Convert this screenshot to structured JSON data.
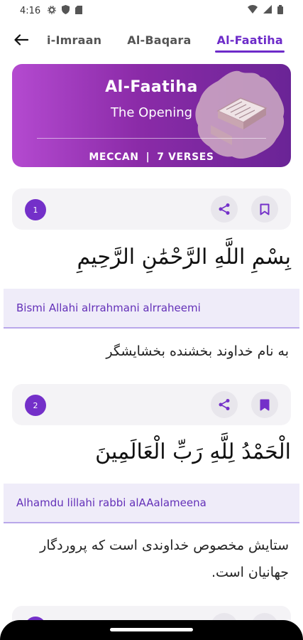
{
  "status_bar": {
    "time": "4:16",
    "icons": [
      "settings-icon",
      "shield-icon",
      "sd-card-icon"
    ],
    "right_icons": [
      "wifi-icon",
      "signal-icon",
      "battery-icon"
    ]
  },
  "nav": {
    "back_icon": "arrow-left-icon",
    "tabs": [
      {
        "label": "i-Imraan",
        "active": false
      },
      {
        "label": "Al-Baqara",
        "active": false
      },
      {
        "label": "Al-Faatiha",
        "active": true
      }
    ]
  },
  "surah": {
    "name": "Al-Faatiha",
    "meaning": "The Opening",
    "type": "MECCAN",
    "separator": "|",
    "verses": "7 VERSES"
  },
  "verses": [
    {
      "number": "1",
      "arabic": "بِسْمِ اللَّهِ الرَّحْمَٰنِ الرَّحِيمِ",
      "transliteration": "Bismi Allahi alrrahmani alrraheemi",
      "translation": "به نام خداوند بخشنده بخشایشگر",
      "bookmarked": false
    },
    {
      "number": "2",
      "arabic": "الْحَمْدُ لِلَّهِ رَبِّ الْعَالَمِينَ",
      "transliteration": "Alhamdu lillahi rabbi alAAalameena",
      "translation": "ستایش مخصوص خداوندی است که پروردگار جهانیان است.",
      "bookmarked": true
    }
  ],
  "colors": {
    "accent": "#6d2bc9",
    "header_gradient_start": "#b44ad0",
    "header_gradient_end": "#6a2496",
    "translit_bg": "#efecf9",
    "translit_text": "#6330b8"
  }
}
